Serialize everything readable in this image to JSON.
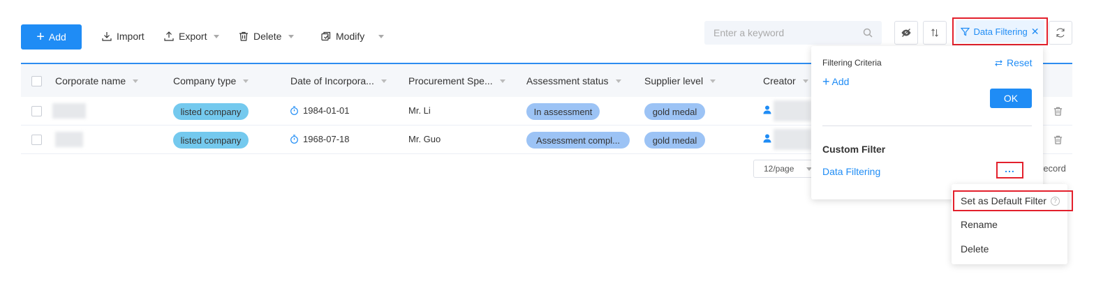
{
  "toolbar": {
    "add_label": "Add",
    "import_label": "Import",
    "export_label": "Export",
    "delete_label": "Delete",
    "modify_label": "Modify"
  },
  "search": {
    "placeholder": "Enter a keyword"
  },
  "data_filter_button": {
    "label": "Data Filtering"
  },
  "table": {
    "columns": [
      "Corporate name",
      "Company type",
      "Date of Incorpora...",
      "Procurement Spe...",
      "Assessment status",
      "Supplier level",
      "Creator"
    ],
    "rows": [
      {
        "company_type": "listed company",
        "date": "1984-01-01",
        "procurement": "Mr. Li",
        "assessment": "In assessment",
        "level": "gold medal"
      },
      {
        "company_type": "listed company",
        "date": "1968-07-18",
        "procurement": "Mr. Guo",
        "assessment": "Assessment compl...",
        "level": "gold medal"
      }
    ]
  },
  "pagination": {
    "page_size": "12/page",
    "record_text": "record"
  },
  "filter_panel": {
    "criteria_title": "Filtering Criteria",
    "reset_label": "Reset",
    "add_label": "Add",
    "ok_label": "OK",
    "custom_filter_title": "Custom Filter",
    "saved_filter_name": "Data Filtering",
    "more_label": "..."
  },
  "context_menu": {
    "set_default": "Set as Default Filter",
    "rename": "Rename",
    "delete": "Delete"
  },
  "colors": {
    "primary": "#1f8cf5",
    "highlight_border": "#e3202c",
    "tag_listed": "#74c9ee",
    "tag_status": "#9cc3f5"
  }
}
